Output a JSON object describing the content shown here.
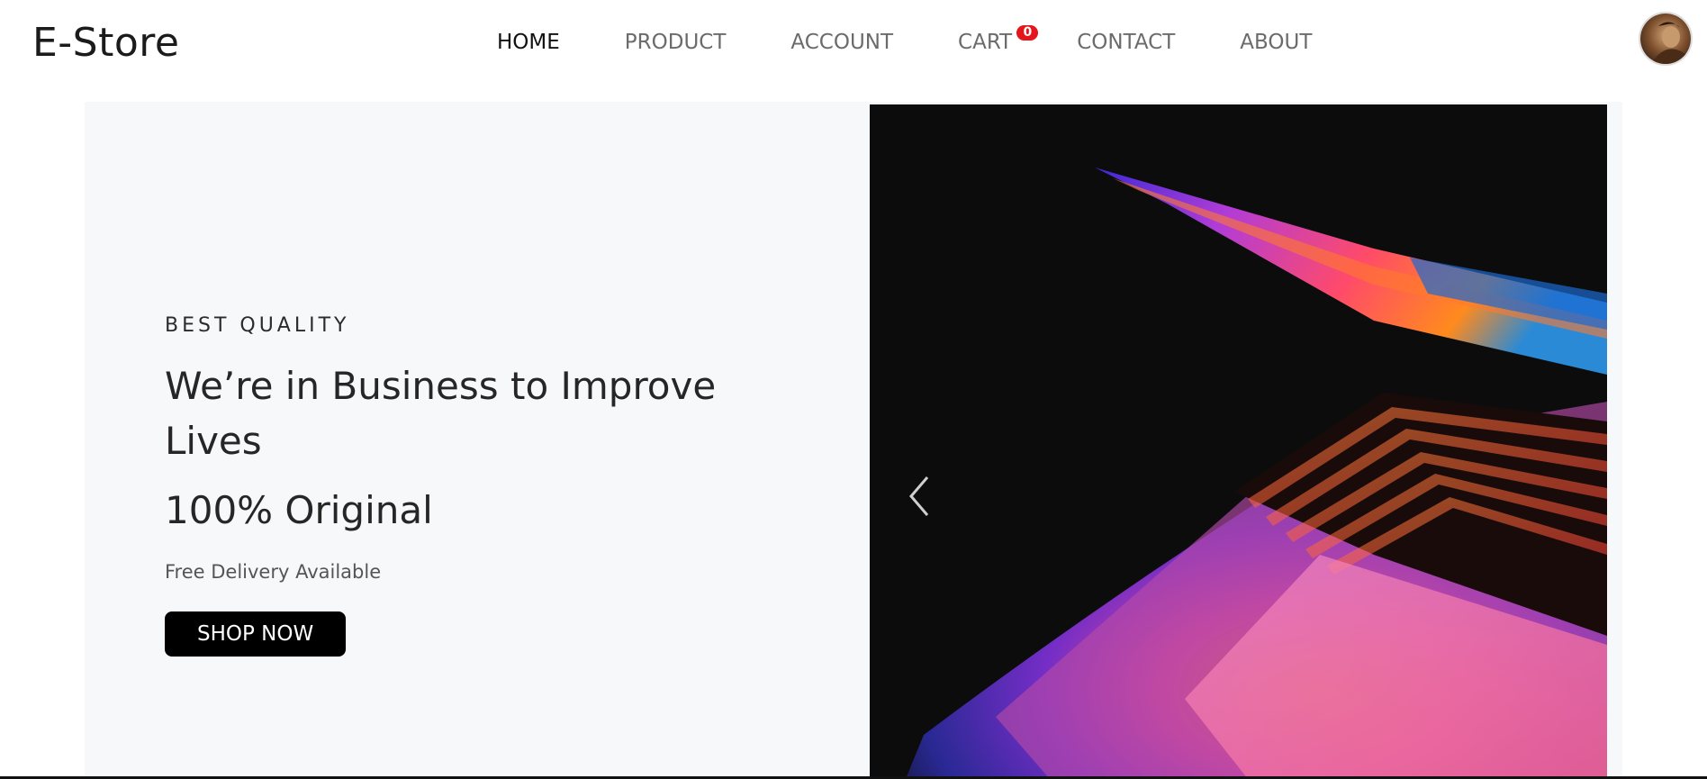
{
  "header": {
    "brand": "E-Store",
    "nav": [
      {
        "label": "HOME",
        "active": true
      },
      {
        "label": "PRODUCT",
        "active": false
      },
      {
        "label": "ACCOUNT",
        "active": false
      },
      {
        "label": "CART",
        "active": false
      },
      {
        "label": "CONTACT",
        "active": false
      },
      {
        "label": "ABOUT",
        "active": false
      }
    ],
    "cart_count": "0"
  },
  "hero": {
    "eyebrow": "BEST QUALITY",
    "headline": "We’re in Business to Improve Lives",
    "sub_headline": "100% Original",
    "delivery": "Free Delivery Available",
    "cta": "SHOP NOW"
  },
  "colors": {
    "badge": "#e5151c",
    "button_bg": "#000000",
    "hero_bg": "#f7f8f9"
  }
}
